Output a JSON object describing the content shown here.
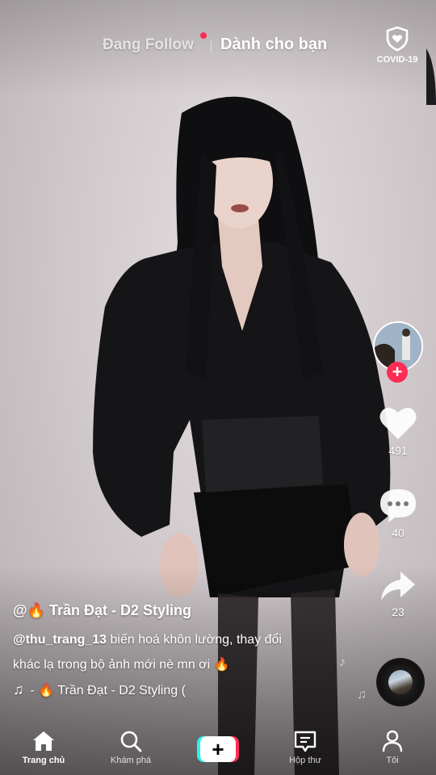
{
  "top_tabs": {
    "following": "Đang Follow",
    "for_you": "Dành cho bạn",
    "covid": "COVID-19"
  },
  "actions": {
    "likes": "491",
    "comments": "40",
    "shares": "23"
  },
  "caption": {
    "author": "@🔥 Trần Đạt - D2 Styling",
    "mention": "@thu_trang_13",
    "text_line1": " biến hoá khôn lường, thay đổi",
    "text_line2": "khác lạ trong bộ ảnh mới nè mn ơi 🔥",
    "music": "- 🔥 Trần Đạt - D2 Styling ("
  },
  "icons": {
    "covid": "shield-heart-icon",
    "like": "heart-icon",
    "comment": "comment-bubble-icon",
    "share": "share-arrow-icon",
    "music": "music-note-icon"
  },
  "nav": {
    "home": "Trang chủ",
    "discover": "Khám phá",
    "inbox": "Hộp thư",
    "me": "Tôi"
  },
  "colors": {
    "accent": "#fe2c55",
    "cyan": "#25f4ee"
  }
}
